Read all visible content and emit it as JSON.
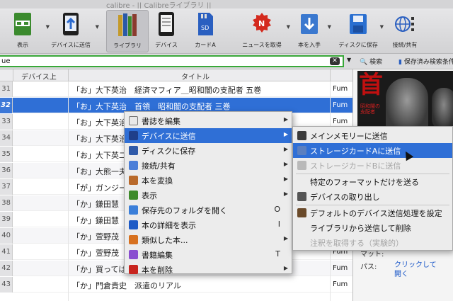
{
  "window": {
    "title": "calibre - || Calibreライブラリ ||"
  },
  "toolbar": [
    {
      "label": "表示",
      "icon": "glasses-book-icon"
    },
    {
      "label": "デバイスに送信",
      "icon": "send-to-device-icon"
    },
    {
      "label": "ライブラリ",
      "icon": "library-books-icon"
    },
    {
      "label": "デバイス",
      "icon": "reader-device-icon"
    },
    {
      "label": "カードA",
      "icon": "sd-card-icon"
    },
    {
      "label": "ニュースを取得",
      "icon": "news-icon"
    },
    {
      "label": "本を入手",
      "icon": "download-book-icon"
    },
    {
      "label": "ディスクに保存",
      "icon": "floppy-save-icon"
    },
    {
      "label": "接続/共有",
      "icon": "network-share-icon"
    }
  ],
  "search": {
    "value": "ue",
    "search_label": "検索",
    "saved_label": "保存済み検索条件"
  },
  "table": {
    "columns": {
      "device": "デバイス上",
      "title": "タイトル"
    },
    "rows": [
      {
        "num": "31",
        "title": "「お」大下英治　経済マフィア＿昭和闇の支配者 五巻",
        "author": "Fum"
      },
      {
        "num": "32",
        "title": "「お」大下英治　首領　昭和闇の支配者 三巻",
        "author": "Fum"
      },
      {
        "num": "33",
        "title": "「お」大下英治",
        "author": "Fum"
      },
      {
        "num": "34",
        "title": "「お」大下英治",
        "author": "Fum"
      },
      {
        "num": "35",
        "title": "「お」大下英二",
        "author": "Fum"
      },
      {
        "num": "36",
        "title": "「お」大熊一夫",
        "author": "Fum"
      },
      {
        "num": "37",
        "title": "「が」ガンジー",
        "author": "Fum"
      },
      {
        "num": "38",
        "title": "「か」鎌田慧",
        "author": "Fum"
      },
      {
        "num": "39",
        "title": "「か」鎌田慧",
        "author": "Fum"
      },
      {
        "num": "40",
        "title": "「か」萱野茂",
        "author": "Fum"
      },
      {
        "num": "41",
        "title": "「か」萱野茂",
        "author": "Fum"
      },
      {
        "num": "42",
        "title": "「か」買ってはいけない Part2",
        "author": "Fum"
      },
      {
        "num": "43",
        "title": "「か」門倉貴史　派遣のリアル",
        "author": "Fum"
      }
    ]
  },
  "details": {
    "format_label": "マット:",
    "path_label": "パス:",
    "path_link": "クリックして開く"
  },
  "context_menu": [
    {
      "label": "書誌を編集",
      "icon": "edit-metadata-icon",
      "color": "#e8e8e8",
      "submenu": true
    },
    {
      "label": "デバイスに送信",
      "icon": "device-icon",
      "color": "#1f3f8a",
      "submenu": true,
      "highlighted": true
    },
    {
      "label": "ディスクに保存",
      "icon": "save-disk-icon",
      "color": "#2f5aa8",
      "submenu": true
    },
    {
      "label": "接続/共有",
      "icon": "share-icon",
      "color": "#4a7ed8",
      "submenu": true
    },
    {
      "label": "本を変換",
      "icon": "convert-book-icon",
      "color": "#b8692a",
      "submenu": true
    },
    {
      "label": "表示",
      "icon": "view-book-icon",
      "color": "#3d8a2a",
      "submenu": true
    },
    {
      "label": "保存先のフォルダを開く",
      "icon": "folder-icon",
      "color": "#3b7fd9",
      "shortcut": "O"
    },
    {
      "label": "本の詳細を表示",
      "icon": "info-icon",
      "color": "#1e5bc6",
      "shortcut": "I"
    },
    {
      "label": "類似した本...",
      "icon": "similar-books-icon",
      "color": "#d7711f",
      "submenu": true
    },
    {
      "label": "書籍編集",
      "icon": "edit-book-icon",
      "color": "#8a4fd0",
      "shortcut": "T"
    },
    {
      "label": "本を削除",
      "icon": "delete-book-icon",
      "color": "#c8241e",
      "submenu": true
    }
  ],
  "submenu": [
    {
      "label": "メインメモリーに送信",
      "icon": "main-memory-icon"
    },
    {
      "label": "ストレージカードAに送信",
      "icon": "card-a-icon",
      "highlighted": true
    },
    {
      "label": "ストレージカードBに送信",
      "icon": "card-b-icon",
      "disabled": true
    },
    {
      "label": "特定のフォーマットだけを送る",
      "icon": ""
    },
    {
      "label": "デバイスの取り出し",
      "icon": "eject-icon"
    },
    {
      "label": "デフォルトのデバイス送信処理を設定",
      "icon": "tools-icon"
    },
    {
      "label": "ライブラリから送信して削除",
      "icon": ""
    },
    {
      "label": "注釈を取得する（実験的）",
      "icon": "",
      "disabled": true
    }
  ]
}
